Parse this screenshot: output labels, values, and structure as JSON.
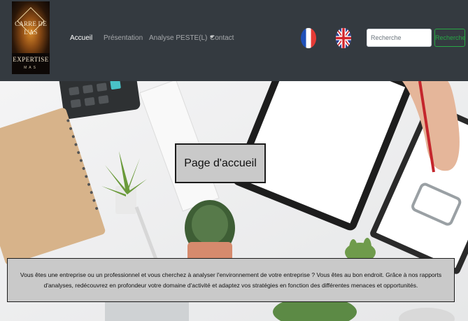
{
  "logo": {
    "top_line_1": "CARRE DE",
    "top_line_2": "L'AS",
    "word": "EXPERTISE",
    "tagline": "MAS"
  },
  "nav": {
    "items": [
      {
        "label": "Accueil",
        "active": true
      },
      {
        "label": "Présentation",
        "active": false
      },
      {
        "label": "Analyse PESTE(L)",
        "active": false,
        "dropdown": true
      },
      {
        "label": "Contact",
        "active": false
      }
    ]
  },
  "languages": [
    {
      "code": "fr",
      "icon": "flag-france-icon"
    },
    {
      "code": "en",
      "icon": "flag-uk-icon"
    }
  ],
  "search": {
    "placeholder": "Recherche",
    "button_label": "Recherche",
    "button_color": "#28a745"
  },
  "hero": {
    "title": "Page d'accueil",
    "description": "Vous êtes une entreprise ou un professionnel et vous cherchez à analyser l'environnement de votre entreprise ? Vous êtes au bon endroit. Grâce à nos rapports d'analyses, redécouvrez en profondeur votre domaine d'activité et adaptez vos stratégies en fonction des différentes menaces et opportunités."
  },
  "colors": {
    "navbar": "#343a40",
    "overlay_box": "#c9c9c9"
  }
}
